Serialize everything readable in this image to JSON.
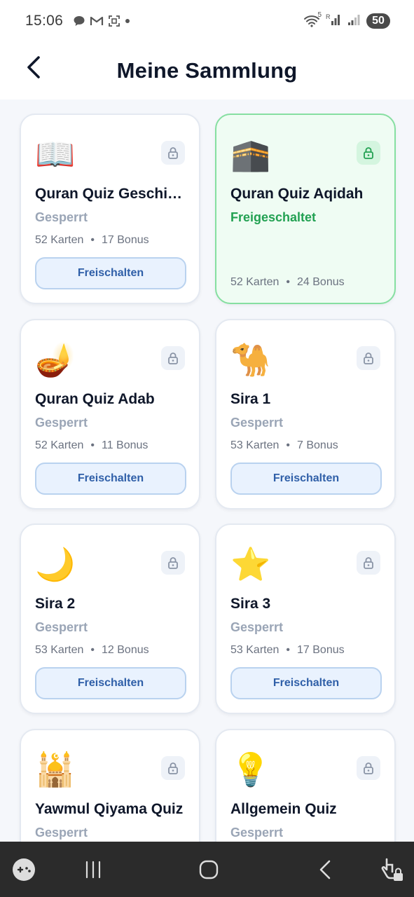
{
  "status_bar": {
    "time": "15:06",
    "left_icons": [
      "chat-bubble-icon",
      "gmail-icon",
      "screenshot-icon",
      "dot-icon"
    ],
    "right_icons": [
      "wifi-icon",
      "signal-r-icon",
      "signal-icon"
    ],
    "wifi_label": "5",
    "battery": "50"
  },
  "header": {
    "title": "Meine Sammlung",
    "back_icon": "chevron-left-icon"
  },
  "colors": {
    "unlocked_border": "#86dfa1",
    "unlocked_bg": "#effcf3",
    "unlocked_text": "#22a152",
    "locked_text": "#9aa5b6",
    "button_bg": "#e9f2fe",
    "button_text": "#2f5fa8"
  },
  "collections": [
    {
      "emoji": "📖",
      "icon": "open-book-icon",
      "title": "Quran Quiz Geschichten",
      "status": "Gesperrt",
      "cards": "52 Karten",
      "bonus": "17 Bonus",
      "button": "Freischalten",
      "locked": true
    },
    {
      "emoji": "🕋",
      "icon": "kaaba-icon",
      "title": "Quran Quiz Aqidah",
      "status": "Freigeschaltet",
      "cards": "52 Karten",
      "bonus": "24 Bonus",
      "button": "",
      "locked": false
    },
    {
      "emoji": "🪔",
      "icon": "oil-lamp-icon",
      "title": "Quran Quiz Adab",
      "status": "Gesperrt",
      "cards": "52 Karten",
      "bonus": "11 Bonus",
      "button": "Freischalten",
      "locked": true
    },
    {
      "emoji": "🐪",
      "icon": "camel-icon",
      "title": "Sira 1",
      "status": "Gesperrt",
      "cards": "53 Karten",
      "bonus": "7 Bonus",
      "button": "Freischalten",
      "locked": true
    },
    {
      "emoji": "🌙",
      "icon": "crescent-moon-icon",
      "title": "Sira 2",
      "status": "Gesperrt",
      "cards": "53 Karten",
      "bonus": "12 Bonus",
      "button": "Freischalten",
      "locked": true
    },
    {
      "emoji": "⭐",
      "icon": "star-icon",
      "title": "Sira 3",
      "status": "Gesperrt",
      "cards": "53 Karten",
      "bonus": "17 Bonus",
      "button": "Freischalten",
      "locked": true
    },
    {
      "emoji": "🕌",
      "icon": "mosque-icon",
      "title": "Yawmul Qiyama Quiz",
      "status": "Gesperrt",
      "cards": "",
      "bonus": "",
      "button": "",
      "locked": true
    },
    {
      "emoji": "💡",
      "icon": "light-bulb-icon",
      "title": "Allgemein Quiz",
      "status": "Gesperrt",
      "cards": "",
      "bonus": "",
      "button": "",
      "locked": true
    }
  ],
  "nav_bar": {
    "items": [
      "gamepad-icon",
      "recent-apps-icon",
      "home-icon",
      "back-icon",
      "touch-lock-icon"
    ]
  }
}
